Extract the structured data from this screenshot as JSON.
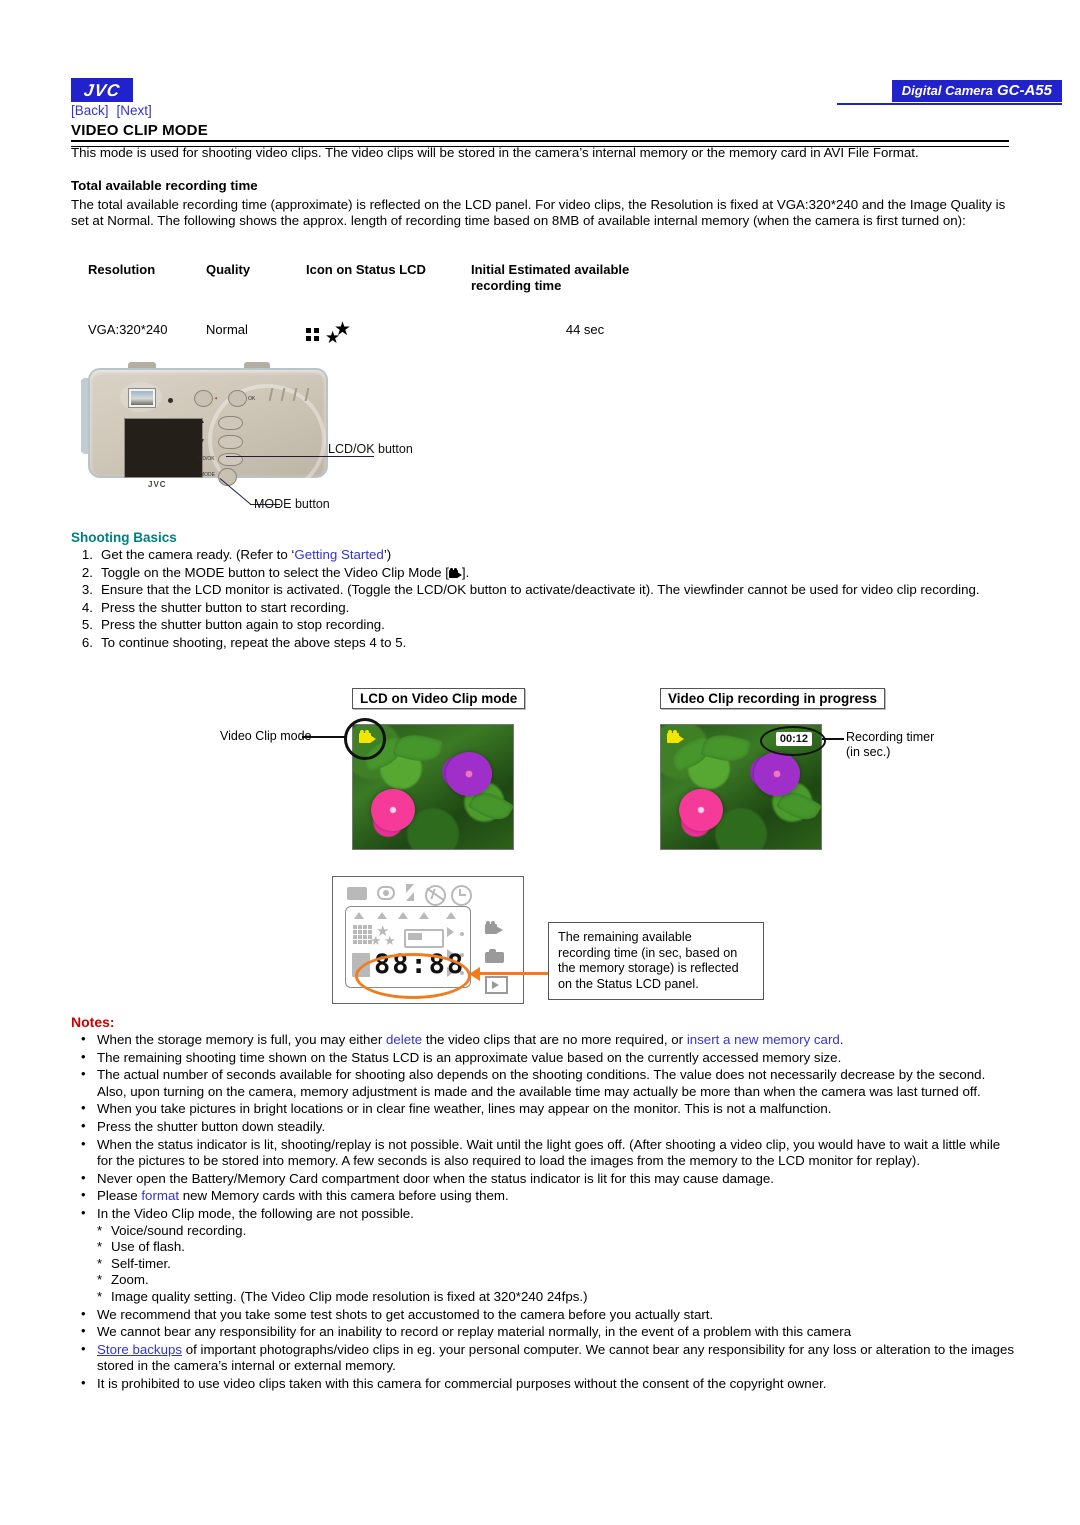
{
  "header": {
    "brand": "JVC",
    "model_badge_prefix": "Digital Camera",
    "model_badge": "GC-A55",
    "nav": [
      {
        "label": "[Back]"
      },
      {
        "label": "[Next]"
      }
    ],
    "page_title": "VIDEO CLIP MODE"
  },
  "intro": "This mode is used for shooting video clips. The video clips will be stored in the camera’s internal memory or the memory card in AVI File Format.",
  "section_recording": {
    "heading": "Total available recording time",
    "body": "The total available recording time (approximate) is reflected on the LCD panel. For video clips, the Resolution is fixed at VGA:320*240 and the Image Quality is set at Normal. The following shows the approx. length of recording time based on 8MB of available internal memory (when the camera is first turned on):"
  },
  "spec_table": {
    "headers": [
      "Resolution",
      "Quality",
      "Icon on Status LCD",
      "Initial Estimated available recording time"
    ],
    "header_line1": "Initial Estimated available",
    "header_line2": "recording time",
    "rows": [
      {
        "resolution": "VGA:320*240",
        "quality": "Normal",
        "icon": "grid-star-icon",
        "time": "44 sec"
      }
    ]
  },
  "camera_figure": {
    "callout_lcd_ok": "LCD/OK button",
    "callout_mode": "MODE button",
    "body_brand": "JVC",
    "button_labels": [
      "MODE",
      "LCD/OK"
    ]
  },
  "shooting_basics": {
    "title": "Shooting Basics",
    "steps": [
      {
        "num": "1.",
        "pre": "Get the camera ready. (Refer to ‘",
        "link": "Getting Started",
        "post": "’)"
      },
      {
        "num": "2.",
        "pre": "Toggle on the MODE button to select the Video Clip Mode [",
        "post": "]."
      },
      {
        "num": "3.",
        "pre": "Ensure that the LCD monitor is activated. (Toggle the LCD/OK button to activate/deactivate it). The viewfinder cannot be used for video clip recording.",
        "post": ""
      },
      {
        "num": "4.",
        "pre": "Press the shutter button to start recording.",
        "post": ""
      },
      {
        "num": "5.",
        "pre": "Press the shutter button again to stop recording.",
        "post": ""
      },
      {
        "num": "6.",
        "pre": "To continue shooting, repeat the above steps 4 to 5.",
        "post": ""
      }
    ]
  },
  "lcd_figure": {
    "label_left": "LCD on Video Clip mode",
    "label_right": "Video Clip recording in progress",
    "callout_mode": "Video Clip mode",
    "callout_timer_line1": "Recording timer",
    "callout_timer_line2": "(in sec.)",
    "timer_value": "00:12",
    "mode_icon": "video-camera-icon"
  },
  "status_lcd_figure": {
    "segment_display": "88:88",
    "note_line1": "The remaining available",
    "note_line2": "recording time (in sec, based on",
    "note_line3": "the memory storage) is reflected",
    "note_line4": "on the Status LCD panel.",
    "icons": [
      "card-icon",
      "red-eye-icon",
      "flash-icon",
      "flash-off-icon",
      "self-timer-icon",
      "video-icon",
      "camera-icon",
      "playback-icon"
    ]
  },
  "notes": {
    "title": "Notes:",
    "items": [
      {
        "parts": [
          {
            "t": "When the storage memory is full, you may either ",
            "k": "plain"
          },
          {
            "t": "delete",
            "k": "link"
          },
          {
            "t": " the video clips that are no more required, or ",
            "k": "plain"
          },
          {
            "t": "insert a new memory card",
            "k": "link"
          },
          {
            "t": ".",
            "k": "plain"
          }
        ]
      },
      {
        "parts": [
          {
            "t": "The remaining shooting time shown on the Status LCD is an approximate value based on the currently accessed memory size.",
            "k": "plain"
          }
        ]
      },
      {
        "parts": [
          {
            "t": "The actual number of seconds available for shooting also depends on the shooting conditions. The value does not necessarily decrease by the second. Also, upon turning on the camera, memory adjustment is made and the available time may actually be more than when the camera was last turned off.",
            "k": "plain"
          }
        ]
      },
      {
        "parts": [
          {
            "t": "When you take pictures in bright locations or in clear fine weather, lines may appear on the monitor. This is not a malfunction.",
            "k": "plain"
          }
        ]
      },
      {
        "parts": [
          {
            "t": "Press the shutter button down steadily.",
            "k": "plain"
          }
        ]
      },
      {
        "parts": [
          {
            "t": "When the status indicator is lit, shooting/replay is not possible. Wait until the light goes off. (After shooting a video clip, you would have to wait a little while for the pictures to be stored into memory. A few seconds is also required to load the images from the memory to the LCD monitor for replay).",
            "k": "plain"
          }
        ]
      },
      {
        "parts": [
          {
            "t": "Never open the Battery/Memory Card compartment door when the status indicator is lit for this may cause damage.",
            "k": "plain"
          }
        ]
      },
      {
        "parts": [
          {
            "t": "Please ",
            "k": "plain"
          },
          {
            "t": "format",
            "k": "link"
          },
          {
            "t": " new Memory cards with this camera before using them.",
            "k": "plain"
          }
        ]
      },
      {
        "parts": [
          {
            "t": "In the Video Clip mode, the following are not possible.",
            "k": "plain"
          }
        ],
        "sub": [
          "Voice/sound recording.",
          "Use of flash.",
          "Self-timer.",
          "Zoom.",
          "Image quality setting. (The Video Clip mode resolution is fixed at 320*240 24fps.)"
        ]
      },
      {
        "parts": [
          {
            "t": "We recommend that you take some test shots to get accustomed to the camera before you actually start.",
            "k": "plain"
          }
        ]
      },
      {
        "parts": [
          {
            "t": "We cannot bear any responsibility for an inability to record or replay material normally, in the event of a problem with this camera",
            "k": "plain"
          }
        ]
      },
      {
        "parts": [
          {
            "t": "Store backups",
            "k": "link-underline"
          },
          {
            "t": " of important photographs/video clips in eg. your personal computer. We cannot bear any responsibility for any loss or alteration to the images stored in the camera’s internal or external memory.",
            "k": "plain"
          }
        ]
      },
      {
        "parts": [
          {
            "t": "It is prohibited to use video clips taken with this camera for commercial purposes without the consent of the copyright owner.",
            "k": "plain"
          }
        ]
      }
    ]
  },
  "colors": {
    "brand_blue": "#2222cc",
    "link_blue": "#3333cc",
    "teal": "#008080",
    "notes_red": "#cc0000",
    "orange": "#f07c1e",
    "lcd_yellow": "#f5e400"
  }
}
